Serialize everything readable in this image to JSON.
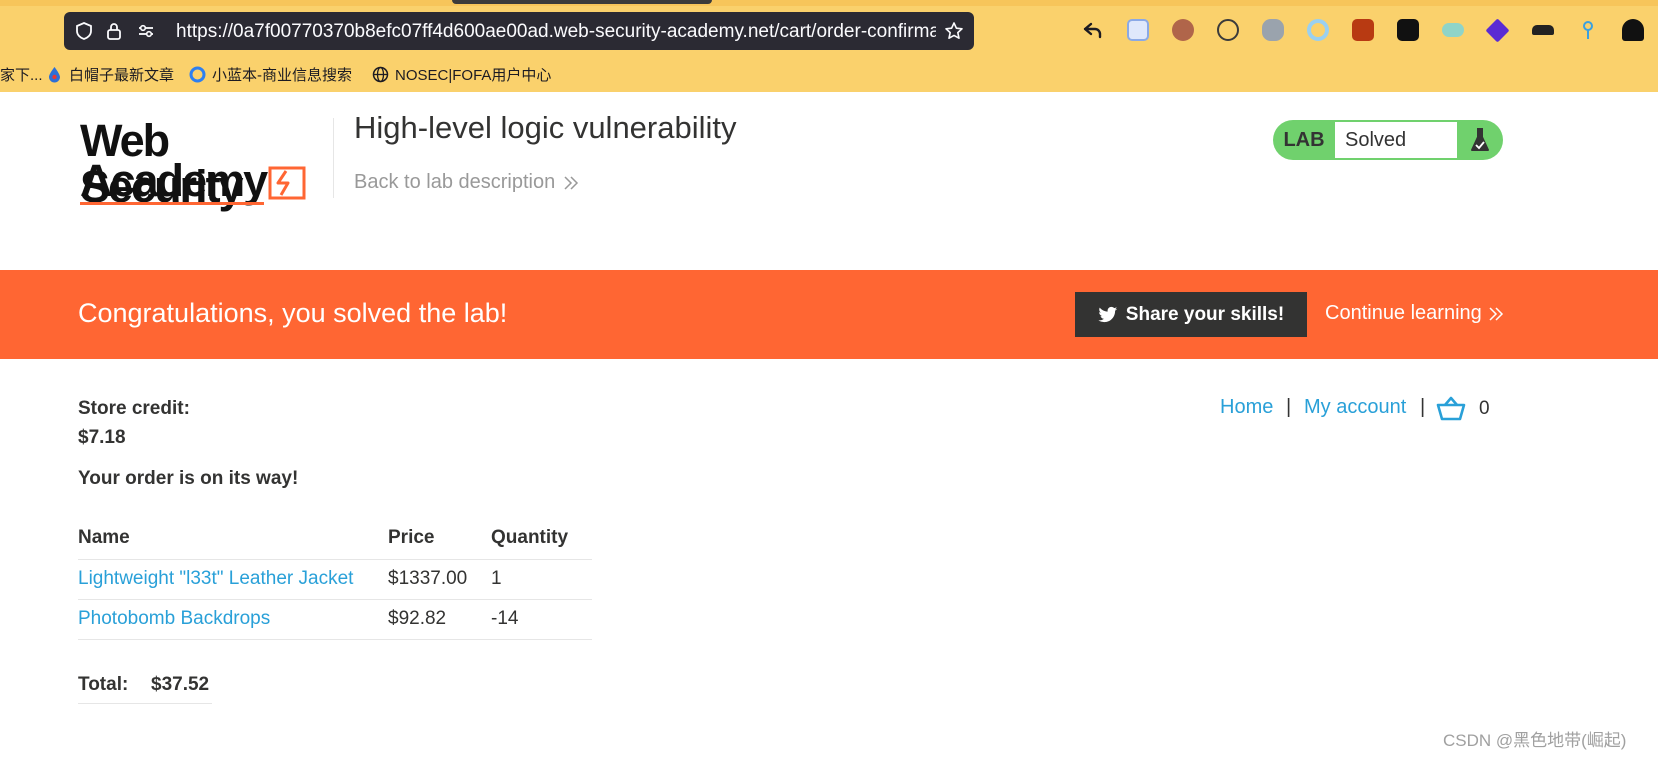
{
  "browser": {
    "url": "https://0a7f00770370b8efc07ff4d600ae00ad.web-security-academy.net/cart/order-confirma",
    "extensions": [
      {
        "name": "back-arrow-icon",
        "color": "#1c1b22"
      },
      {
        "name": "bird-extension-icon",
        "color": "#8aa9e6"
      },
      {
        "name": "cookie-extension-icon",
        "color": "#b0654a"
      },
      {
        "name": "cookie-outline-extension-icon",
        "color": "#3b3b3b"
      },
      {
        "name": "puzzle-extension-icon",
        "color": "#9aa3ad"
      },
      {
        "name": "ring-extension-icon",
        "color": "#9ad0f0"
      },
      {
        "name": "burp-extension-icon",
        "color": "#b83a12"
      },
      {
        "name": "glasses-extension-icon",
        "color": "#111111"
      },
      {
        "name": "toggle-extension-icon",
        "color": "#8fd4c8"
      },
      {
        "name": "diamond-extension-icon",
        "color": "#5a2bd4"
      },
      {
        "name": "hat-extension-icon",
        "color": "#222222"
      },
      {
        "name": "pin-extension-icon",
        "color": "#3aa0e0"
      },
      {
        "name": "hacker-extension-icon",
        "color": "#111111"
      }
    ],
    "bookmarks": [
      {
        "label": "家下..."
      },
      {
        "label": "白帽子最新文章"
      },
      {
        "label": "小蓝本-商业信息搜索"
      },
      {
        "label": "NOSEC|FOFA用户中心"
      }
    ]
  },
  "header": {
    "logo_line1": "Web Security",
    "logo_line2": "Academy",
    "lab_title": "High-level logic vulnerability",
    "back_link": "Back to lab description",
    "badge_label": "LAB",
    "badge_status": "Solved"
  },
  "banner": {
    "message": "Congratulations, you solved the lab!",
    "share_label": "Share your skills!",
    "continue_label": "Continue learning"
  },
  "nav": {
    "home": "Home",
    "separator": "|",
    "account": "My account",
    "cart_count": "0"
  },
  "account": {
    "credit_label": "Store credit:",
    "credit_value": "$7.18",
    "order_message": "Your order is on its way!"
  },
  "order_table": {
    "headers": [
      "Name",
      "Price",
      "Quantity"
    ],
    "rows": [
      [
        "Lightweight \"l33t\" Leather Jacket",
        "$1337.00",
        "1"
      ],
      [
        "Photobomb Backdrops",
        "$92.82",
        "-14"
      ]
    ],
    "total_label": "Total:",
    "total_value": "$37.52"
  },
  "watermark": "CSDN @黑色地带(崛起)",
  "colors": {
    "accent_orange": "#ff6633",
    "link_blue": "#29a0d8",
    "solved_green": "#70d16d",
    "chrome_yellow": "#fad16c"
  }
}
